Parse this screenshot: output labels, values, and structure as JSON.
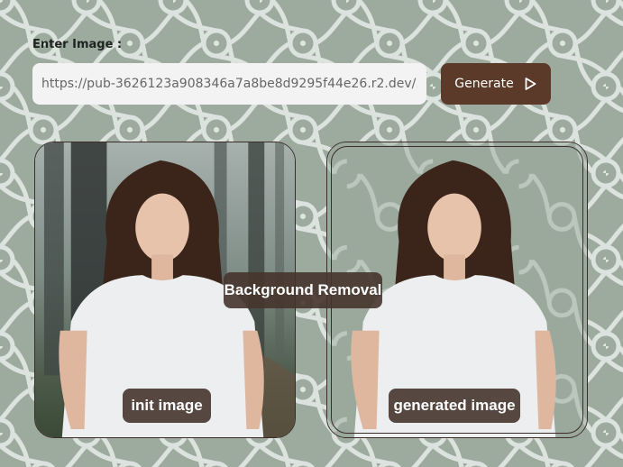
{
  "form": {
    "enter_label": "Enter Image :",
    "url_value": "https://pub-3626123a908346a7a8be8d9295f44e26.r2.dev/...",
    "generate_label": "Generate"
  },
  "panels": {
    "init_label": "init image",
    "generated_label": "generated image",
    "center_label": "Background Removal"
  },
  "colors": {
    "background": "#9dab9f",
    "pattern": "#e8ede8",
    "button": "#5b3a2a",
    "chip": "#46342c"
  },
  "icons": {
    "generate_icon": "play-icon"
  }
}
